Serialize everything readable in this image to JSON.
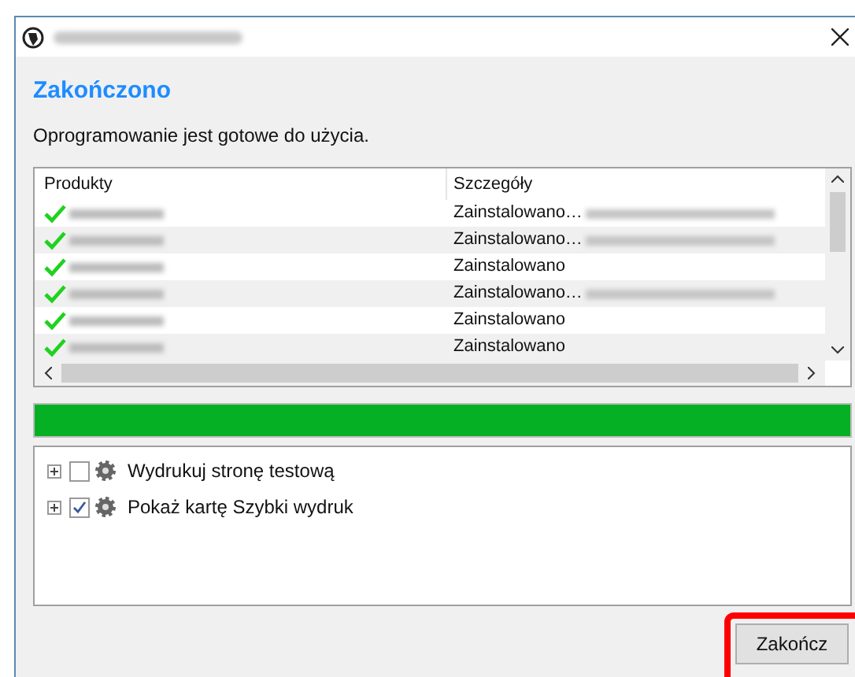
{
  "heading": "Zakończono",
  "message": "Oprogramowanie jest gotowe do użycia.",
  "table": {
    "columns": [
      "Produkty",
      "Szczegóły"
    ],
    "rows": [
      {
        "done": true,
        "details": "Zainstalowano…",
        "redacted_extra": true
      },
      {
        "done": true,
        "details": "Zainstalowano…",
        "redacted_extra": true
      },
      {
        "done": true,
        "details": "Zainstalowano",
        "redacted_extra": false
      },
      {
        "done": true,
        "details": "Zainstalowano…",
        "redacted_extra": true
      },
      {
        "done": true,
        "details": "Zainstalowano",
        "redacted_extra": false
      },
      {
        "done": true,
        "details": "Zainstalowano",
        "redacted_extra": false
      }
    ]
  },
  "progress": {
    "level": 1
  },
  "options": [
    {
      "label": "Wydrukuj stronę testową",
      "checked": false
    },
    {
      "label": "Pokaż kartę Szybki wydruk",
      "checked": true
    }
  ],
  "finish_button": {
    "label": "Zakończ",
    "highlighted": true
  }
}
